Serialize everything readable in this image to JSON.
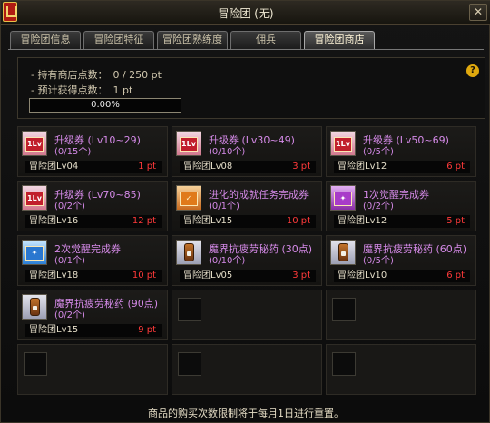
{
  "window": {
    "title": "冒险团 (无)",
    "close_label": "✕"
  },
  "tabs": [
    {
      "label": "冒险团信息",
      "active": false
    },
    {
      "label": "冒险团特征",
      "active": false
    },
    {
      "label": "冒险团熟练度",
      "active": false
    },
    {
      "label": "佣兵",
      "active": false
    },
    {
      "label": "冒险团商店",
      "active": true
    }
  ],
  "points": {
    "held_label": "- 持有商店点数：",
    "held_value": "0 / 250 pt",
    "expected_label": "- 预计获得点数：",
    "expected_value": "1 pt",
    "progress_text": "0.00%",
    "progress_fraction": 0,
    "help_label": "?"
  },
  "items": [
    {
      "name": "升级券 (Lv10~29)",
      "limit": "(0/15个)",
      "req": "冒险团Lv04",
      "price": "1 pt",
      "icon": "level-ticket-icon"
    },
    {
      "name": "升级券 (Lv30~49)",
      "limit": "(0/10个)",
      "req": "冒险团Lv08",
      "price": "3 pt",
      "icon": "level-ticket-icon"
    },
    {
      "name": "升级券 (Lv50~69)",
      "limit": "(0/5个)",
      "req": "冒险团Lv12",
      "price": "6 pt",
      "icon": "level-ticket-icon"
    },
    {
      "name": "升级券 (Lv70~85)",
      "limit": "(0/2个)",
      "req": "冒险团Lv16",
      "price": "12 pt",
      "icon": "level-ticket-icon"
    },
    {
      "name": "进化的成就任务完成券",
      "limit": "(0/1个)",
      "req": "冒险团Lv15",
      "price": "10 pt",
      "icon": "quest-ticket-icon"
    },
    {
      "name": "1次觉醒完成券",
      "limit": "(0/2个)",
      "req": "冒险团Lv12",
      "price": "5 pt",
      "icon": "awakening-ticket-icon"
    },
    {
      "name": "2次觉醒完成券",
      "limit": "(0/1个)",
      "req": "冒险团Lv18",
      "price": "10 pt",
      "icon": "awakening2-ticket-icon"
    },
    {
      "name": "魔界抗疲劳秘药 (30点)",
      "limit": "(0/10个)",
      "req": "冒险团Lv05",
      "price": "3 pt",
      "icon": "potion-icon"
    },
    {
      "name": "魔界抗疲劳秘药 (60点)",
      "limit": "(0/5个)",
      "req": "冒险团Lv10",
      "price": "6 pt",
      "icon": "potion-icon"
    },
    {
      "name": "魔界抗疲劳秘药 (90点)",
      "limit": "(0/2个)",
      "req": "冒险团Lv15",
      "price": "9 pt",
      "icon": "potion-icon"
    }
  ],
  "footer": "商品的购买次数限制将于每月1日进行重置。"
}
